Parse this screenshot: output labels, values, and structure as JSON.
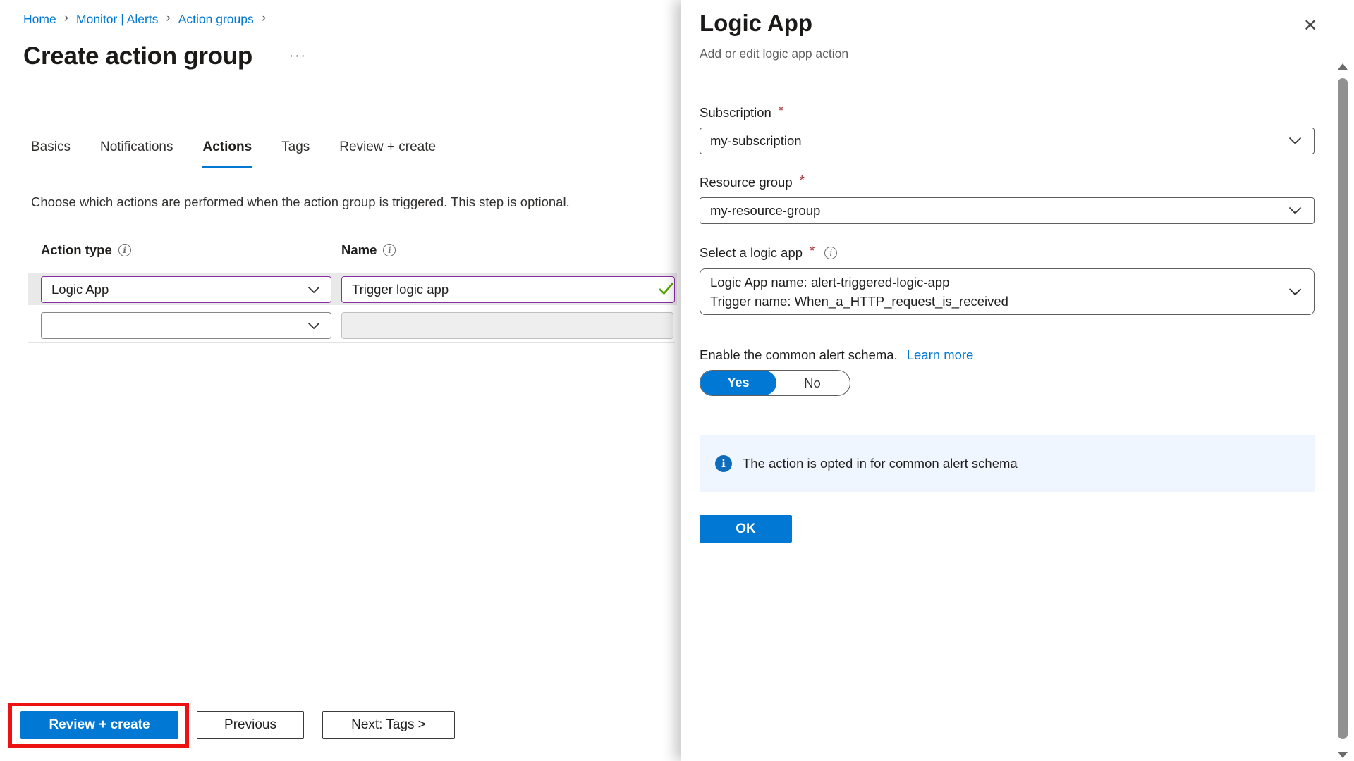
{
  "icons": {
    "close": "✕",
    "breadcrumb_separator": "›",
    "title_ellipsis": "···",
    "info": "i"
  },
  "colors": {
    "accent_blue": "#0078d4",
    "purple_highlight": "#8a2da5",
    "valid_green": "#57a300",
    "annotation_red": "#ee1111",
    "required_red": "#a4262c",
    "info_banner_bg": "#f0f6ff"
  },
  "breadcrumb": {
    "items": [
      {
        "label": "Home"
      },
      {
        "label": "Monitor | Alerts"
      },
      {
        "label": "Action groups"
      }
    ]
  },
  "page": {
    "title": "Create action group",
    "description": "Choose which actions are performed when the action group is triggered. This step is optional."
  },
  "tabs": [
    {
      "label": "Basics"
    },
    {
      "label": "Notifications"
    },
    {
      "label": "Actions"
    },
    {
      "label": "Tags"
    },
    {
      "label": "Review + create"
    }
  ],
  "actions_table": {
    "columns": [
      {
        "label": "Action type"
      },
      {
        "label": "Name"
      }
    ],
    "rows": [
      {
        "action_type": "Logic App",
        "name": "Trigger logic app",
        "valid": true
      },
      {
        "action_type": "",
        "name": ""
      }
    ]
  },
  "footer": {
    "review_create_label": "Review + create",
    "previous_label": "Previous",
    "next_label": "Next: Tags >"
  },
  "panel": {
    "title": "Logic App",
    "subtitle": "Add or edit logic app action",
    "subscription": {
      "label": "Subscription",
      "required_mark": "*",
      "value": "my-subscription"
    },
    "resource_group": {
      "label": "Resource group",
      "required_mark": "*",
      "value": "my-resource-group"
    },
    "logic_app": {
      "label": "Select a logic app",
      "required_mark": "*",
      "value_line1": "Logic App name: alert-triggered-logic-app",
      "value_line2": "Trigger name: When_a_HTTP_request_is_received"
    },
    "schema": {
      "text": "Enable the common alert schema.",
      "link": "Learn more",
      "yes_label": "Yes",
      "no_label": "No",
      "selected": "Yes"
    },
    "info_message": "The action is opted in for common alert schema",
    "ok_label": "OK"
  }
}
